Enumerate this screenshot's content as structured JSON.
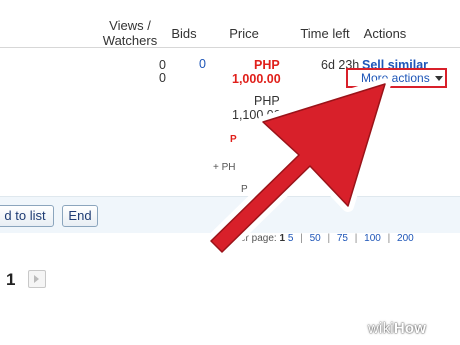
{
  "table": {
    "headers": {
      "views_watchers": "Views / Watchers",
      "bids": "Bids",
      "price": "Price",
      "time_left": "Time left",
      "actions": "Actions"
    },
    "row": {
      "views": "0",
      "watchers": "0",
      "bids": "0",
      "price_red_currency": "PHP",
      "price_red_value": "1,000.00",
      "price_currency": "PHP",
      "price_value": "1,100.00",
      "time_left": "6d 23h",
      "sell_similar": "Sell similar",
      "more_actions": "More actions"
    }
  },
  "fragments": {
    "s1": "P",
    "s2": "+ PH",
    "s3": "P"
  },
  "toolbar": {
    "add_to_list_label": "d to list",
    "end_label": "End"
  },
  "per_page": {
    "label": "er page:",
    "options": [
      "1",
      "5",
      "50",
      "75",
      "100",
      "200"
    ]
  },
  "pager": {
    "current_page": "1"
  },
  "watermark": {
    "prefix": "wiki",
    "suffix": "How"
  },
  "colors": {
    "arrow_fill": "#d8202a",
    "arrow_outline": "#ffffff",
    "link": "#1e56b8",
    "price_red": "#e0201b"
  }
}
